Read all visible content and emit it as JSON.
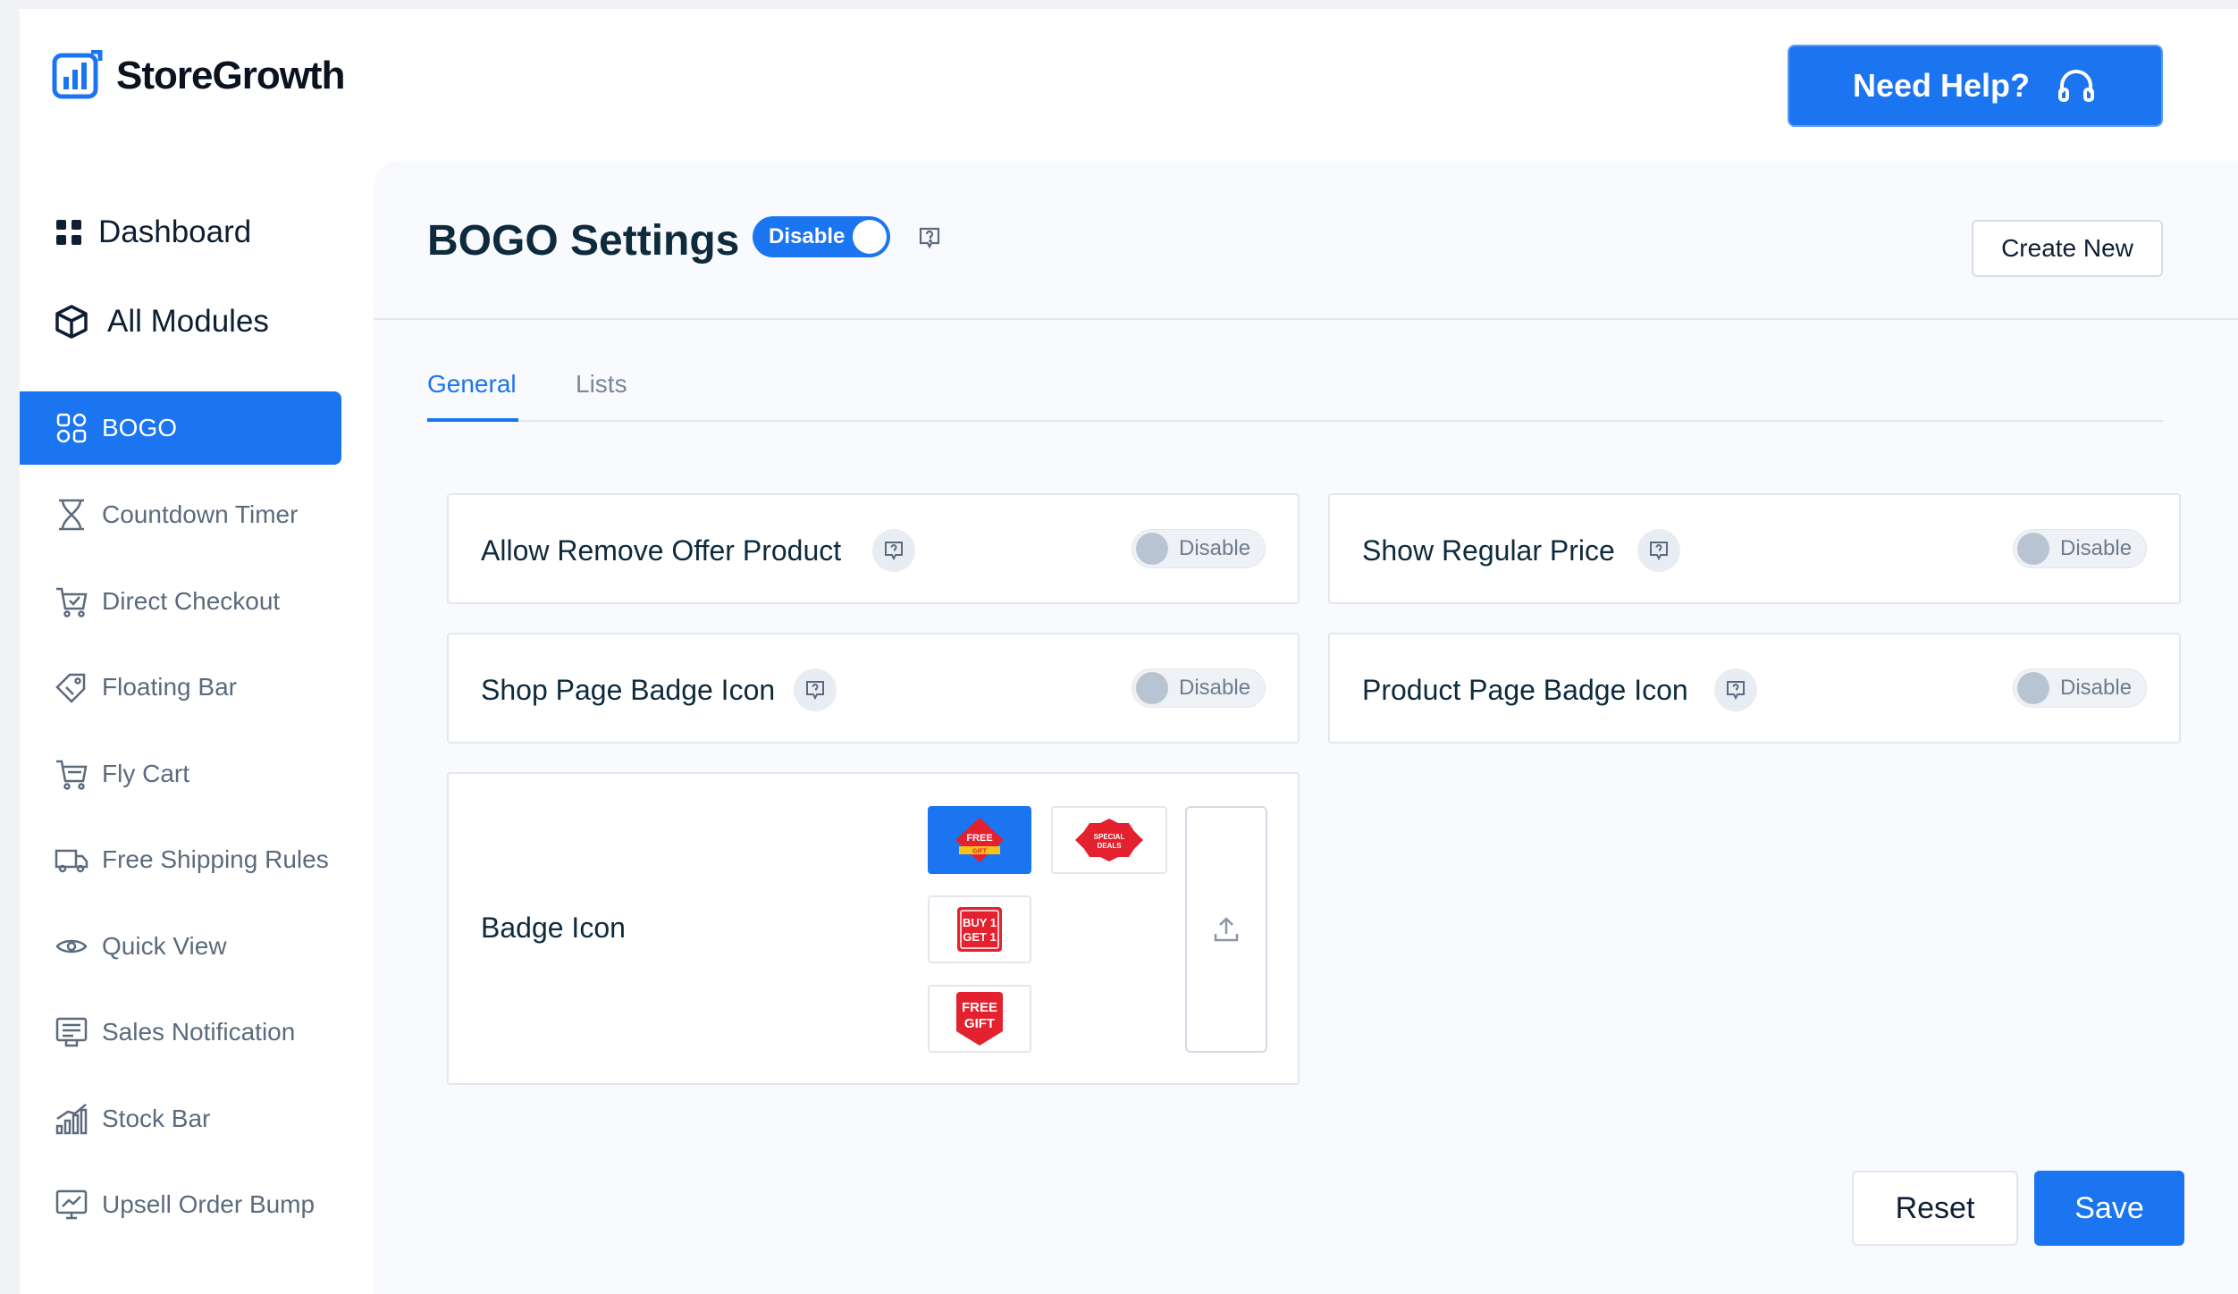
{
  "app": {
    "brand": "StoreGrowth",
    "help_button": "Need Help?",
    "colors": {
      "primary": "#1b74f0",
      "text": "#0e2a3d",
      "muted": "#5b6b7d"
    }
  },
  "sidebar": {
    "top": [
      {
        "label": "Dashboard",
        "icon": "dashboard-grid-icon"
      },
      {
        "label": "All Modules",
        "icon": "cube-icon"
      }
    ],
    "items": [
      {
        "label": "BOGO",
        "icon": "bogo-icon",
        "active": true
      },
      {
        "label": "Countdown Timer",
        "icon": "hourglass-icon"
      },
      {
        "label": "Direct Checkout",
        "icon": "cart-check-icon"
      },
      {
        "label": "Floating Bar",
        "icon": "tag-icon"
      },
      {
        "label": "Fly Cart",
        "icon": "cart-icon"
      },
      {
        "label": "Free Shipping Rules",
        "icon": "truck-icon"
      },
      {
        "label": "Quick View",
        "icon": "eye-icon"
      },
      {
        "label": "Sales Notification",
        "icon": "notification-board-icon"
      },
      {
        "label": "Stock Bar",
        "icon": "bar-chart-icon"
      },
      {
        "label": "Upsell Order Bump",
        "icon": "trend-monitor-icon"
      }
    ]
  },
  "main": {
    "title": "BOGO Settings",
    "master_toggle": "Disable",
    "create_button": "Create New",
    "tabs": [
      {
        "label": "General",
        "active": true
      },
      {
        "label": "Lists",
        "active": false
      }
    ],
    "settings": [
      {
        "label": "Allow Remove Offer Product",
        "toggle": "Disable"
      },
      {
        "label": "Show Regular Price",
        "toggle": "Disable"
      },
      {
        "label": "Shop Page Badge Icon",
        "toggle": "Disable"
      },
      {
        "label": "Product Page Badge Icon",
        "toggle": "Disable"
      }
    ],
    "badge": {
      "label": "Badge Icon",
      "options": [
        "FREE GIFT",
        "SPECIAL DEALS",
        "BUY 1 GET 1",
        "FREE GIFT"
      ],
      "opt_lines": {
        "free_gift_1": "FREE",
        "free_gift_1b": "GIFT",
        "special_1": "SPECIAL",
        "special_2": "DEALS",
        "buy_1": "BUY 1",
        "buy_2": "GET 1",
        "free_gift_2": "FREE",
        "free_gift_2b": "GIFT"
      }
    },
    "reset_button": "Reset",
    "save_button": "Save"
  }
}
